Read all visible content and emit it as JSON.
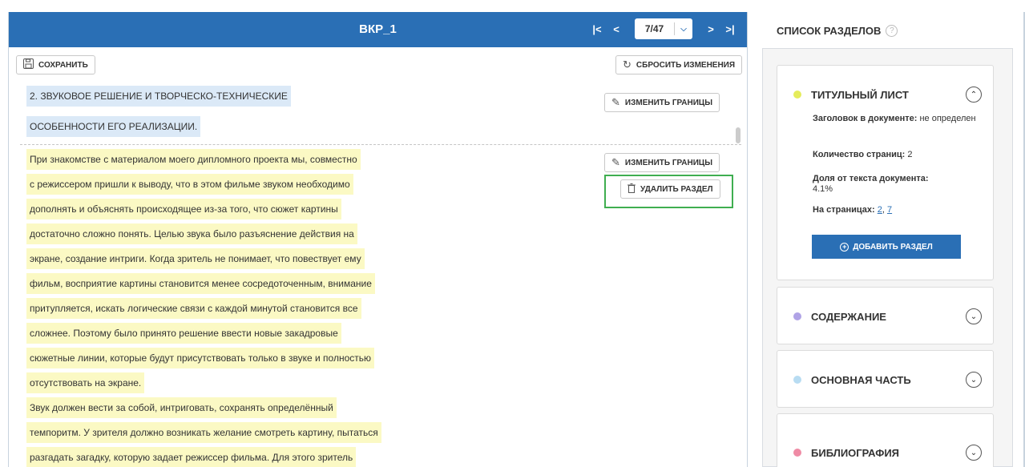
{
  "header": {
    "title": "ВКР_1",
    "first_icon": "|<",
    "prev_icon": "<",
    "page_value": "7/47",
    "next_icon": ">",
    "last_icon": ">|"
  },
  "toolbar": {
    "save_label": "СОХРАНИТЬ",
    "reset_label": "СБРОСИТЬ ИЗМЕНЕНИЯ"
  },
  "section_heading": {
    "lines": [
      "2. ЗВУКОВОЕ РЕШЕНИЕ И ТВОРЧЕСКО-ТЕХНИЧЕСКИЕ",
      "ОСОБЕННОСТИ ЕГО РЕАЛИЗАЦИИ."
    ],
    "edit_bounds_label": "ИЗМЕНИТЬ ГРАНИЦЫ"
  },
  "section_body": {
    "edit_bounds_label": "ИЗМЕНИТЬ ГРАНИЦЫ",
    "delete_label": "УДАЛИТЬ РАЗДЕЛ",
    "lines": [
      "При знакомстве с материалом моего дипломного проекта мы, совместно",
      "с режиссером пришли к выводу, что в этом фильме звуком необходимо",
      "дополнять и объяснять происходящее из-за того, что сюжет картины",
      "достаточно сложно понять. Целью звука было разъяснение действия на",
      "экране, создание интриги. Когда зритель не понимает, что повествует ему",
      "фильм, восприятие картины становится менее сосредоточенным, внимание",
      "притупляется, искать логические связи с каждой минутой становится все",
      "сложнее. Поэтому было принято решение ввести новые закадровые",
      "сюжетные линии, которые будут присутствовать только в звуке и полностью",
      "отсутствовать на экране.",
      "Звук должен вести за собой, интриговать, сохранять определённый",
      "темпоритм. У зрителя должно возникать желание смотреть картину, пытаться",
      "разгадать загадку, которую задает режиссер фильма. Для этого зритель"
    ]
  },
  "sidebar": {
    "title": "СПИСОК РАЗДЕЛОВ",
    "help_icon": "?",
    "sections": [
      {
        "title": "ТИТУЛЬНЫЙ ЛИСТ",
        "color": "#e5ec5b",
        "expanded": true,
        "heading_label": "Заголовок в документе:",
        "heading_value": "не определен",
        "pages_label": "Количество страниц:",
        "pages_value": "2",
        "share_label": "Доля от текста документа:",
        "share_value": "4.1%",
        "on_pages_label": "На страницах:",
        "on_pages_1": "2",
        "on_pages_2": "7",
        "add_label": "ДОБАВИТЬ РАЗДЕЛ"
      },
      {
        "title": "СОДЕРЖАНИЕ",
        "color": "#b0a3e6",
        "expanded": false
      },
      {
        "title": "ОСНОВНАЯ ЧАСТЬ",
        "color": "#b8dcf2",
        "expanded": false
      },
      {
        "title": "БИБЛИОГРАФИЯ",
        "color": "#ef8ba5",
        "expanded": false
      }
    ]
  }
}
